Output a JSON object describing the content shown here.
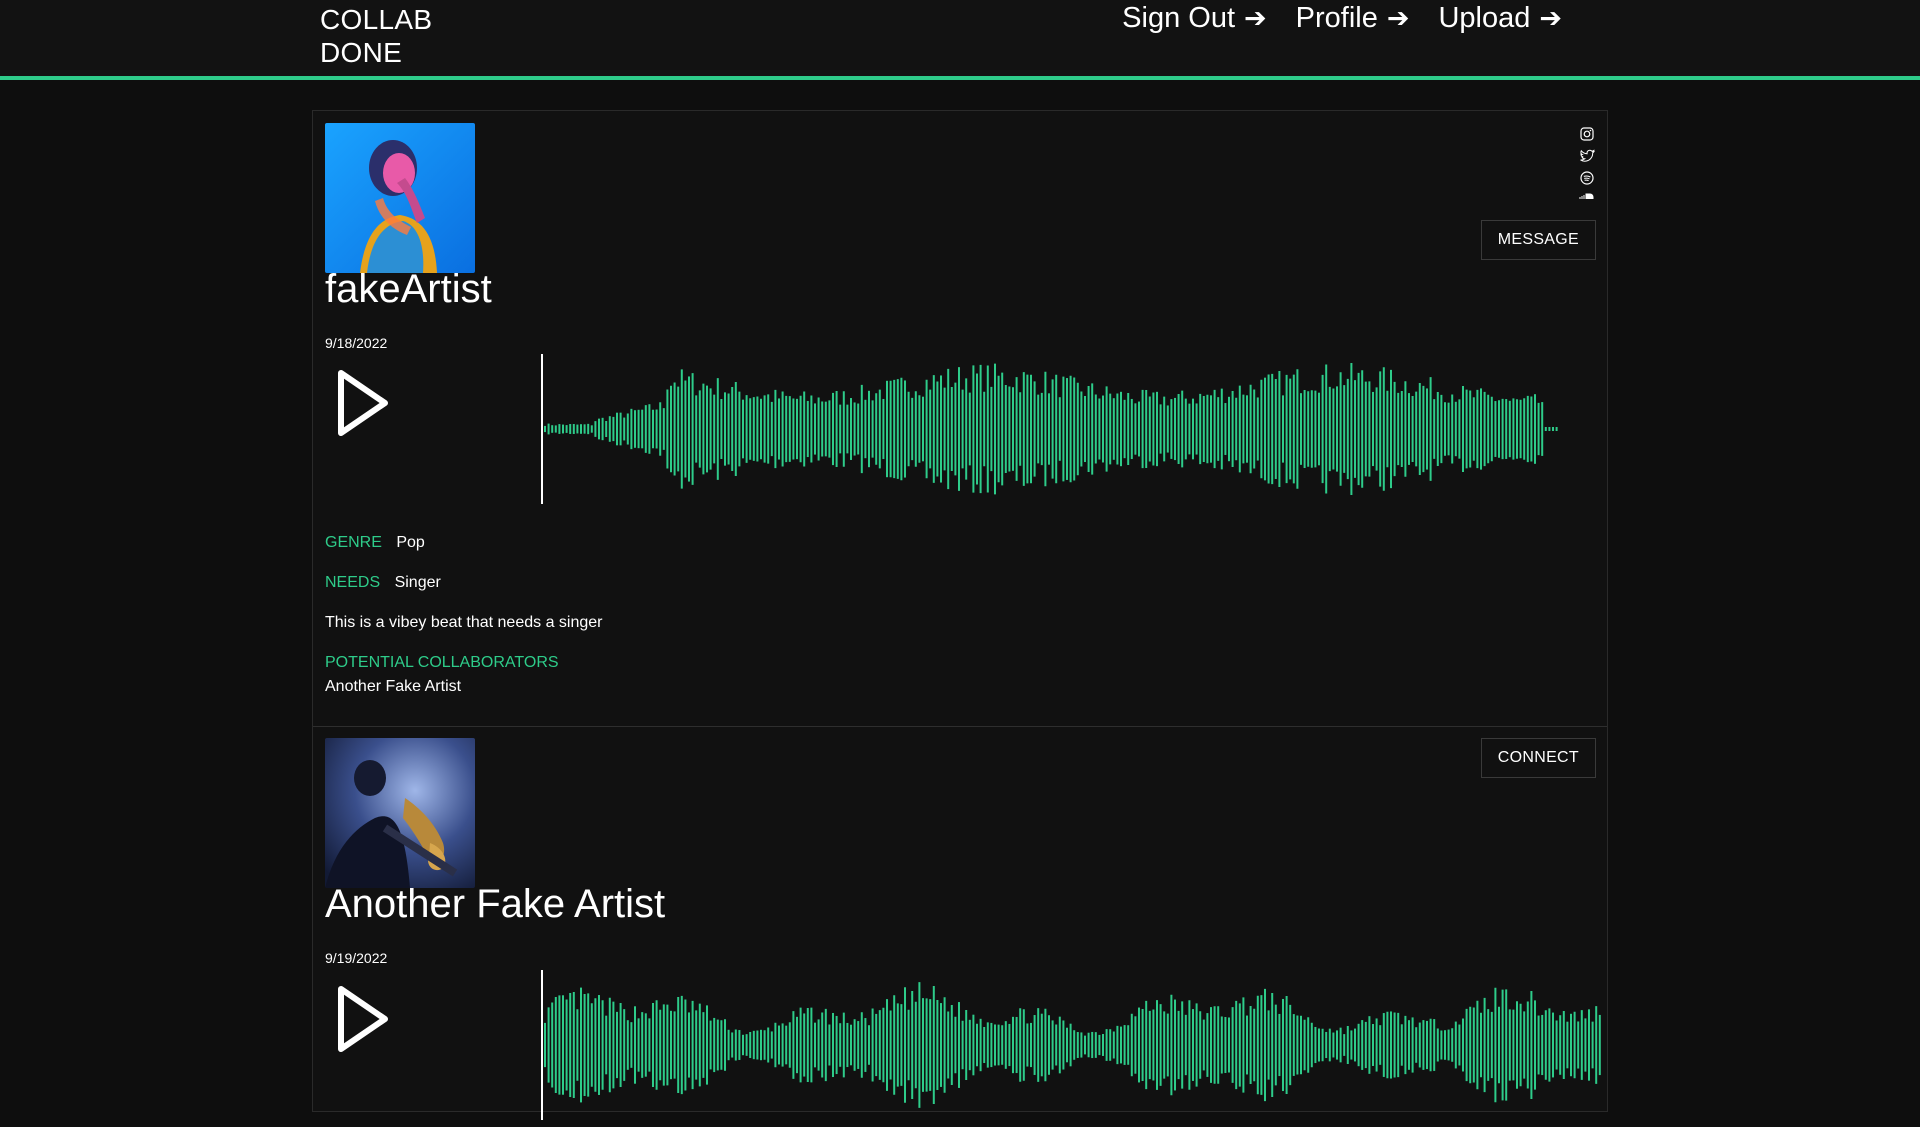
{
  "brand": {
    "line1": "COLLAB",
    "line2": "DONE"
  },
  "nav": [
    {
      "label": "Sign Out"
    },
    {
      "label": "Profile"
    },
    {
      "label": "Upload"
    }
  ],
  "accent_color": "#2ecc8a",
  "posts": [
    {
      "artist": "fakeArtist",
      "date": "9/18/2022",
      "action_button": "MESSAGE",
      "social_icons": [
        "instagram-icon",
        "twitter-icon",
        "spotify-icon",
        "soundcloud-icon"
      ],
      "genre_key": "GENRE",
      "genre": "Pop",
      "needs_key": "NEEDS",
      "needs": "Singer",
      "description": "This is a vibey beat that needs a singer",
      "collaborators_key": "POTENTIAL COLLABORATORS",
      "collaborators": [
        "Another Fake Artist"
      ]
    },
    {
      "artist": "Another Fake Artist",
      "date": "9/19/2022",
      "action_button": "CONNECT"
    }
  ]
}
